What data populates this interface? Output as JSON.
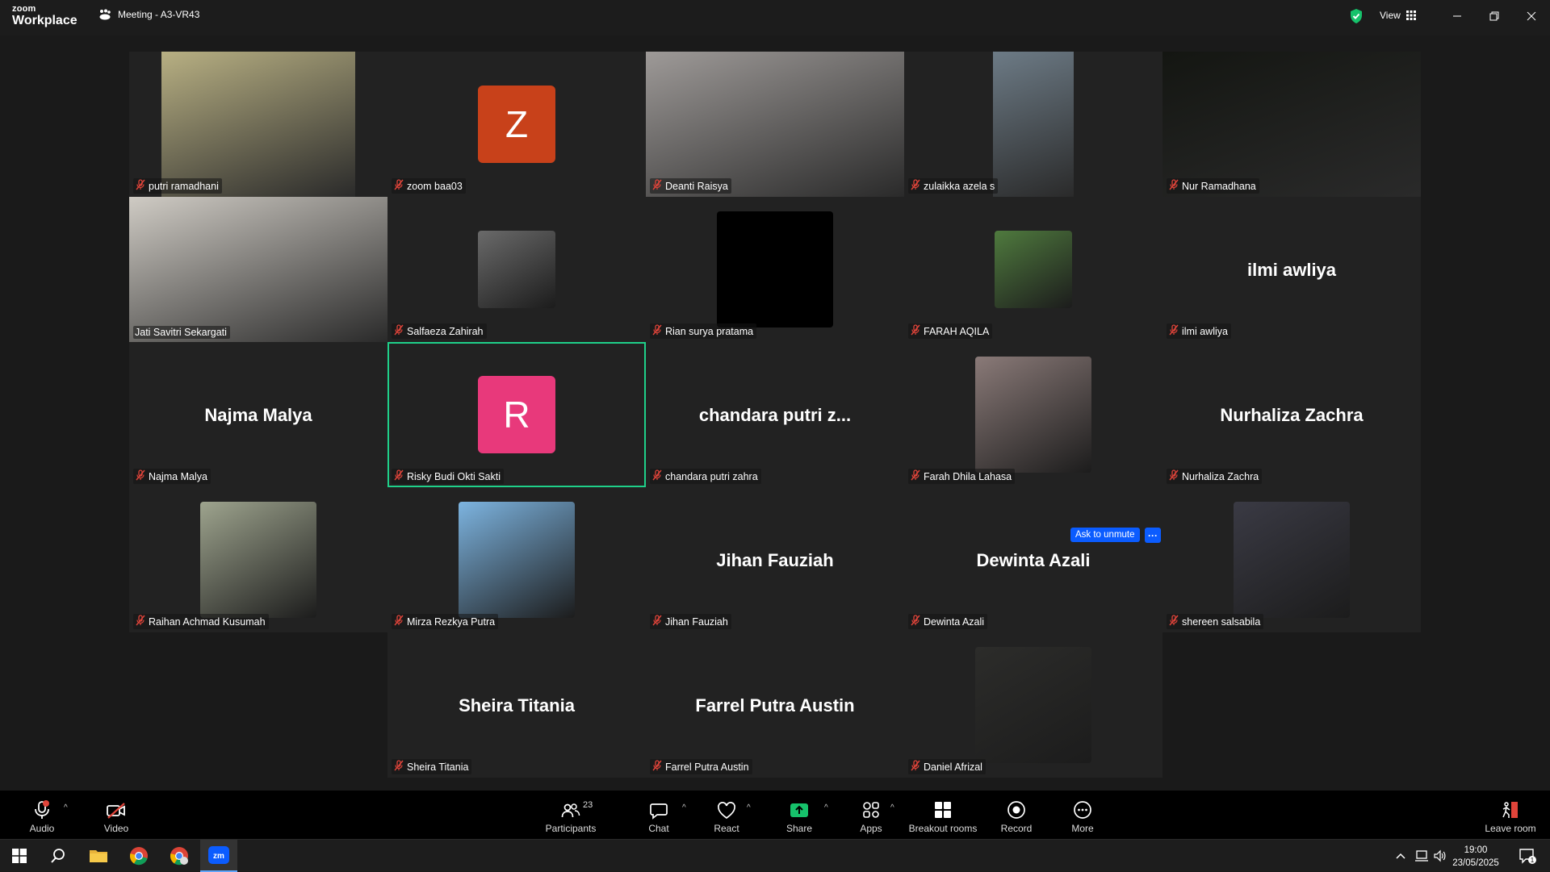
{
  "app": {
    "logo_top": "zoom",
    "logo_bottom": "Workplace",
    "meeting_title": "Meeting - A3-VR43",
    "view_label": "View"
  },
  "tiles": [
    {
      "row": 0,
      "col": 1,
      "name": "putri ramadhani",
      "kind": "video",
      "bg": "#b8b083"
    },
    {
      "row": 0,
      "col": 2,
      "name": "zoom baa03",
      "kind": "avatar",
      "letter": "Z",
      "color": "#c8411a"
    },
    {
      "row": 0,
      "col": 3,
      "name": "Deanti Raisya",
      "kind": "video",
      "bg": "#9e9a98"
    },
    {
      "row": 0,
      "col": 4,
      "name": "zulaikka azela s",
      "kind": "video",
      "bg": "#6d7b86"
    },
    {
      "row": 0,
      "col": 5,
      "name": "Nur Ramadhana",
      "kind": "video",
      "bg": "#141612"
    },
    {
      "row": 1,
      "col": 1,
      "name": "Jati Savitri Sekargati",
      "kind": "video",
      "bg": "#cfcbc4"
    },
    {
      "row": 1,
      "col": 2,
      "name": "Salfaeza Zahirah",
      "kind": "photo",
      "bg": "#6a6a6a"
    },
    {
      "row": 1,
      "col": 3,
      "name": "Rian surya pratama",
      "kind": "photo",
      "bg": "#000000"
    },
    {
      "row": 1,
      "col": 4,
      "name": "FARAH AQILA",
      "kind": "photo",
      "bg": "#4f7a3e"
    },
    {
      "row": 1,
      "col": 5,
      "name": "ilmi awliya",
      "kind": "text",
      "display": "ilmi awliya"
    },
    {
      "row": 2,
      "col": 1,
      "name": "Najma Malya",
      "kind": "text",
      "display": "Najma Malya"
    },
    {
      "row": 2,
      "col": 2,
      "name": "Risky Budi Okti Sakti",
      "kind": "avatar",
      "letter": "R",
      "color": "#e8397b",
      "active": true
    },
    {
      "row": 2,
      "col": 3,
      "name": "chandara putri zahra",
      "kind": "text",
      "display": "chandara putri z..."
    },
    {
      "row": 2,
      "col": 4,
      "name": "Farah Dhila Lahasa",
      "kind": "photo",
      "bg": "#8a7a78"
    },
    {
      "row": 2,
      "col": 5,
      "name": "Nurhaliza Zachra",
      "kind": "text",
      "display": "Nurhaliza Zachra"
    },
    {
      "row": 3,
      "col": 1,
      "name": "Raihan Achmad Kusumah",
      "kind": "photo",
      "bg": "#9ea48e"
    },
    {
      "row": 3,
      "col": 2,
      "name": "Mirza Rezkya Putra",
      "kind": "photo",
      "bg": "#7db4e0"
    },
    {
      "row": 3,
      "col": 3,
      "name": "Jihan Fauziah",
      "kind": "text",
      "display": "Jihan Fauziah"
    },
    {
      "row": 3,
      "col": 4,
      "name": "Dewinta Azali",
      "kind": "text",
      "display": "Dewinta Azali"
    },
    {
      "row": 3,
      "col": 5,
      "name": "shereen salsabila",
      "kind": "photo",
      "bg": "#3a3a44"
    },
    {
      "row": 4,
      "col": 2,
      "name": "Sheira Titania",
      "kind": "text",
      "display": "Sheira Titania"
    },
    {
      "row": 4,
      "col": 3,
      "name": "Farrel Putra Austin",
      "kind": "text",
      "display": "Farrel Putra Austin"
    },
    {
      "row": 4,
      "col": 4,
      "name": "Daniel Afrizal",
      "kind": "photo",
      "bg": "#2c2c2a"
    }
  ],
  "hover": {
    "ask_label": "Ask to unmute",
    "more_label": "···"
  },
  "toolbar": {
    "audio": "Audio",
    "video": "Video",
    "participants": "Participants",
    "participants_count": "23",
    "chat": "Chat",
    "react": "React",
    "share": "Share",
    "apps": "Apps",
    "breakout": "Breakout rooms",
    "record": "Record",
    "more": "More",
    "leave": "Leave room"
  },
  "taskbar": {
    "time": "19:00",
    "date": "23/05/2025",
    "notif_count": "1"
  },
  "colors": {
    "active_speaker": "#1fd08a",
    "share_green": "#16c26b",
    "accent_blue": "#0b5cff",
    "muted_red": "#e0443a"
  }
}
